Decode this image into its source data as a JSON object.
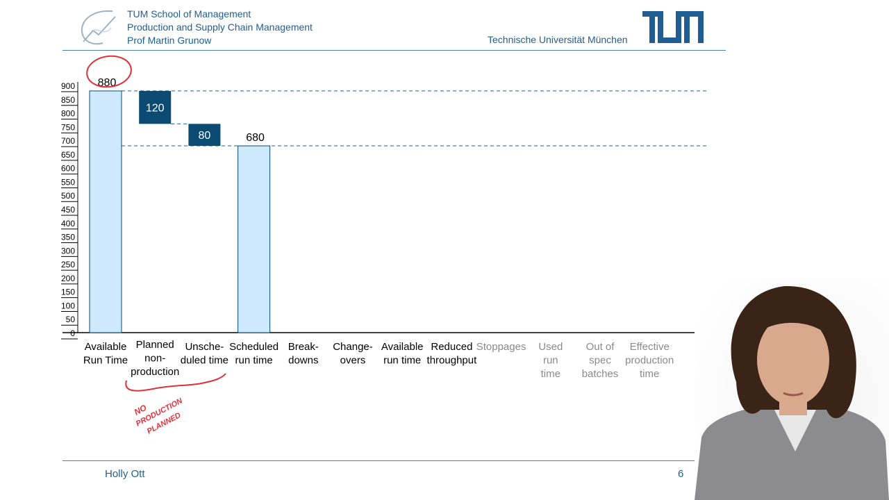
{
  "header": {
    "institution_lines": [
      "TUM School of Management",
      "Production and Supply Chain Management",
      "Prof Martin Grunow"
    ],
    "university": "Technische Universität München",
    "logo_text": "TUM"
  },
  "footer": {
    "presenter_name": "Holly Ott",
    "page_number": "6"
  },
  "annotations": {
    "handwritten": "NO PRODUCTION PLANNED"
  },
  "colors": {
    "accent": "#1f5d93",
    "bar_light": "#cde9fb",
    "bar_dark": "#0b4a73",
    "axis": "#000000",
    "muted_label": "#8a8a8a",
    "ink_red": "#e0313a"
  },
  "chart_data": {
    "type": "bar",
    "subtype": "waterfall",
    "ylim": [
      0,
      900
    ],
    "yticks": [
      0,
      50,
      100,
      150,
      200,
      250,
      300,
      350,
      400,
      450,
      500,
      550,
      600,
      650,
      700,
      750,
      800,
      850,
      900
    ],
    "categories": [
      {
        "label": "Available Run Time",
        "lines": [
          "Available",
          "Run Time"
        ],
        "muted": false
      },
      {
        "label": "Planned non-production",
        "lines": [
          "Planned",
          "non-",
          "production"
        ],
        "muted": false
      },
      {
        "label": "Unscheduled time",
        "lines": [
          "Unsche-",
          "duled time"
        ],
        "muted": false
      },
      {
        "label": "Scheduled run time",
        "lines": [
          "Scheduled",
          "run time"
        ],
        "muted": false
      },
      {
        "label": "Breakdowns",
        "lines": [
          "Break-",
          "downs"
        ],
        "muted": false
      },
      {
        "label": "Changeovers",
        "lines": [
          "Change-",
          "overs"
        ],
        "muted": false
      },
      {
        "label": "Available run time",
        "lines": [
          "Available",
          "run time"
        ],
        "muted": false
      },
      {
        "label": "Reduced throughput",
        "lines": [
          "Reduced",
          "throughput"
        ],
        "muted": false
      },
      {
        "label": "Stoppages",
        "lines": [
          "Stoppages"
        ],
        "muted": true
      },
      {
        "label": "Used run time",
        "lines": [
          "Used",
          "run",
          "time"
        ],
        "muted": true
      },
      {
        "label": "Out of spec batches",
        "lines": [
          "Out of",
          "spec",
          "batches"
        ],
        "muted": true
      },
      {
        "label": "Effective production time",
        "lines": [
          "Effective",
          "production",
          "time"
        ],
        "muted": true
      }
    ],
    "bars": [
      {
        "category_index": 0,
        "kind": "total",
        "base": 0,
        "value": 880,
        "label": "880"
      },
      {
        "category_index": 1,
        "kind": "loss",
        "base": 760,
        "value": 120,
        "label": "120"
      },
      {
        "category_index": 2,
        "kind": "loss",
        "base": 680,
        "value": 80,
        "label": "80"
      },
      {
        "category_index": 3,
        "kind": "total",
        "base": 0,
        "value": 680,
        "label": "680"
      }
    ],
    "reference_lines": [
      880,
      680
    ],
    "connectors": [
      760
    ]
  }
}
